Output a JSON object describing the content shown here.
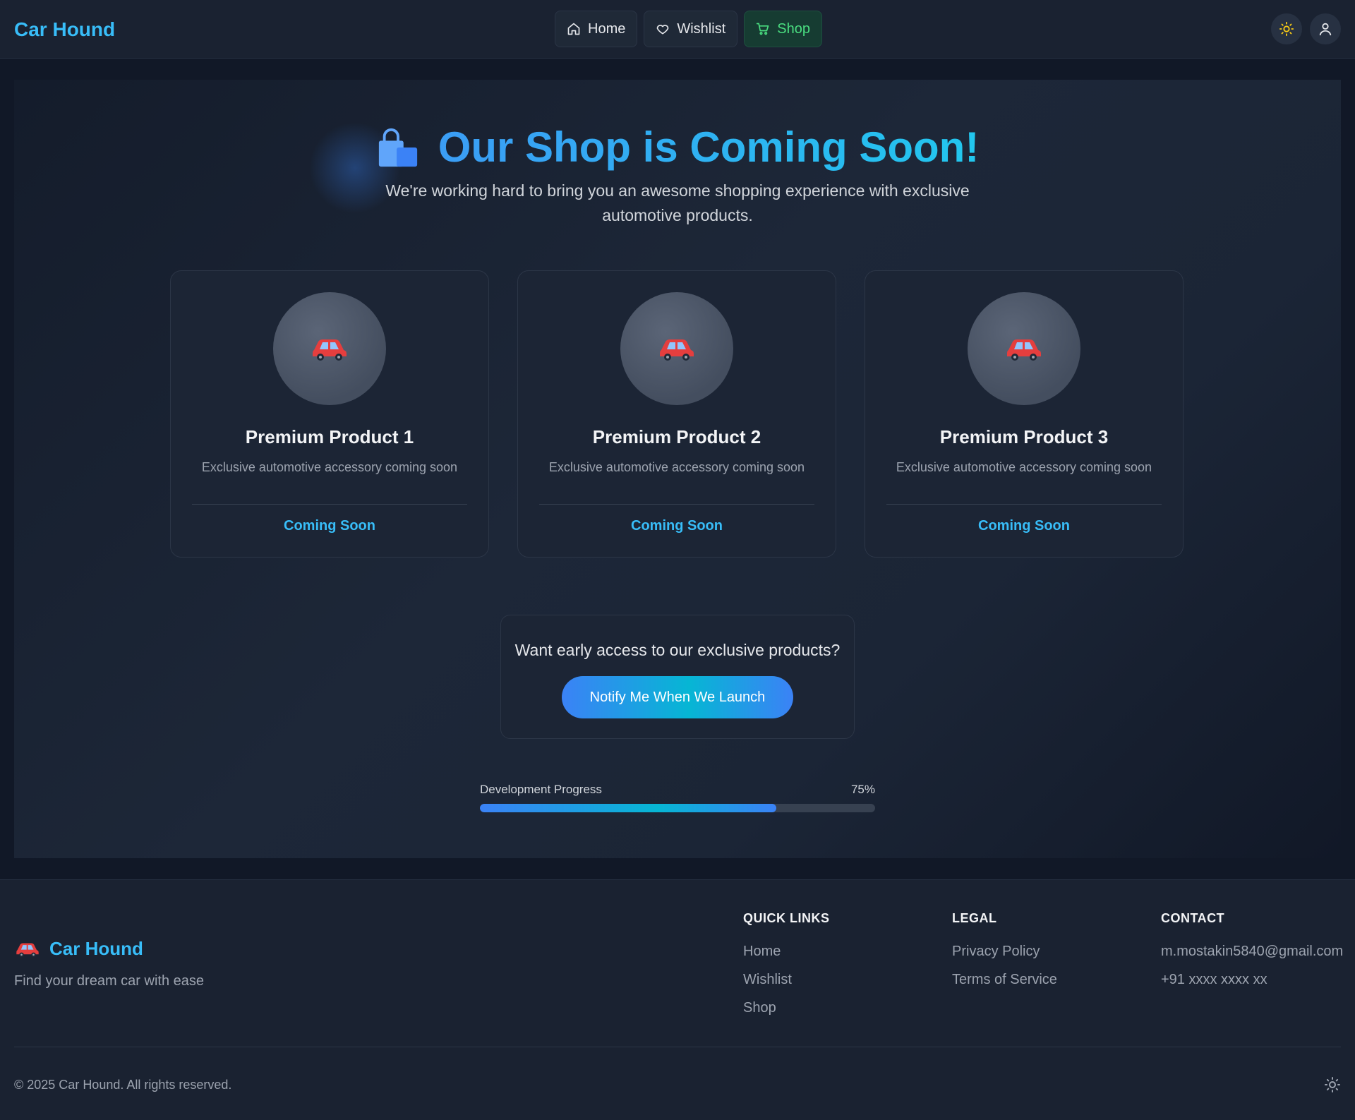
{
  "header": {
    "brand": "Car Hound",
    "nav": [
      {
        "label": "Home",
        "icon": "home-icon"
      },
      {
        "label": "Wishlist",
        "icon": "heart-icon"
      },
      {
        "label": "Shop",
        "icon": "cart-icon",
        "active": true
      }
    ],
    "icons": [
      "sun-icon",
      "user-icon"
    ]
  },
  "hero": {
    "title": "Our Shop is Coming Soon!",
    "subtitle": "We're working hard to bring you an awesome shopping experience with exclusive automotive products."
  },
  "products": [
    {
      "name": "Premium Product 1",
      "description": "Exclusive automotive accessory coming soon",
      "status": "Coming Soon"
    },
    {
      "name": "Premium Product 2",
      "description": "Exclusive automotive accessory coming soon",
      "status": "Coming Soon"
    },
    {
      "name": "Premium Product 3",
      "description": "Exclusive automotive accessory coming soon",
      "status": "Coming Soon"
    }
  ],
  "notify": {
    "prompt": "Want early access to our exclusive products?",
    "button": "Notify Me When We Launch"
  },
  "progress": {
    "label": "Development Progress",
    "value_text": "75%",
    "value": 0.75
  },
  "footer": {
    "brand": "Car Hound",
    "tagline": "Find your dream car with ease",
    "quick_links": {
      "heading": "QUICK LINKS",
      "items": [
        "Home",
        "Wishlist",
        "Shop"
      ]
    },
    "legal": {
      "heading": "LEGAL",
      "items": [
        "Privacy Policy",
        "Terms of Service"
      ]
    },
    "contact": {
      "heading": "CONTACT",
      "items": [
        "m.mostakin5840@gmail.com",
        "+91 xxxx xxxx xx"
      ]
    },
    "copyright": "© 2025 Car Hound. All rights reserved."
  },
  "colors": {
    "accent": "#38bdf8",
    "active_nav": "#4ade80",
    "background": "#111827",
    "card": "#1c2535"
  }
}
